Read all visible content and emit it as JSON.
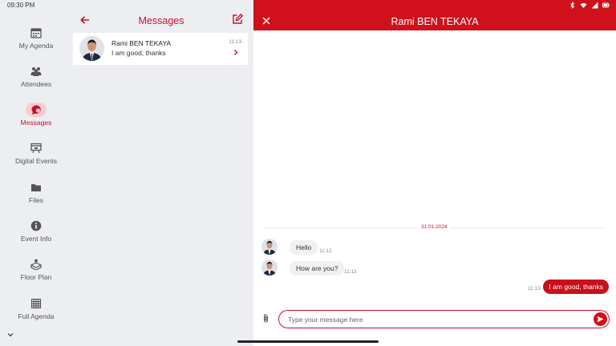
{
  "status_bar": {
    "time": "09:30 PM"
  },
  "nav": {
    "items": [
      {
        "label": "My Agenda",
        "icon": "calendar-icon",
        "active": false
      },
      {
        "label": "Attendees",
        "icon": "people-icon",
        "active": false
      },
      {
        "label": "Messages",
        "icon": "chat-icon",
        "active": true
      },
      {
        "label": "Digital Events",
        "icon": "stage-icon",
        "active": false
      },
      {
        "label": "Files",
        "icon": "folder-icon",
        "active": false
      },
      {
        "label": "Event Info",
        "icon": "info-icon",
        "active": false
      },
      {
        "label": "Floor Plan",
        "icon": "floor-plan-icon",
        "active": false
      },
      {
        "label": "Full Agenda",
        "icon": "grid-calendar-icon",
        "active": false
      }
    ]
  },
  "messages_panel": {
    "title": "Messages",
    "conversations": [
      {
        "name": "Rami BEN TEKAYA",
        "preview": "I am good, thanks",
        "time": "11:13"
      }
    ]
  },
  "chat": {
    "title": "Rami BEN TEKAYA",
    "date": "31.01.2024",
    "messages": [
      {
        "direction": "in",
        "text": "Hello",
        "time": "11:12"
      },
      {
        "direction": "in",
        "text": "How are you?",
        "time": "11:12"
      },
      {
        "direction": "out",
        "text": "I am good, thanks",
        "time": "11:13"
      }
    ],
    "input_placeholder": "Type your message here"
  },
  "colors": {
    "accent": "#c8102e",
    "header": "#d0101a",
    "pane_bg": "#eceef1"
  }
}
